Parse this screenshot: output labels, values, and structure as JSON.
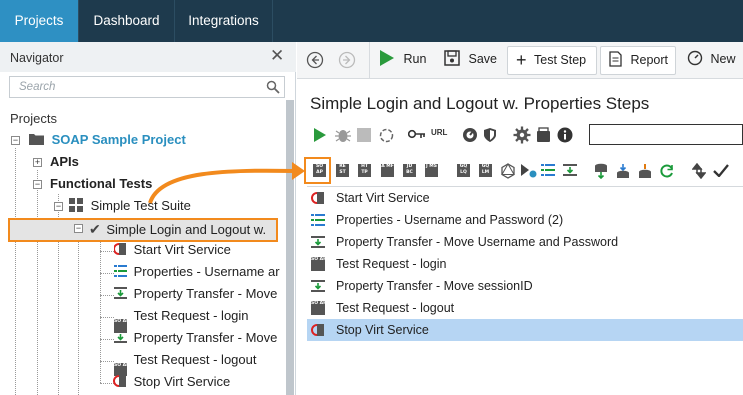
{
  "top_tabs": [
    {
      "label": "Projects",
      "active": true
    },
    {
      "label": "Dashboard",
      "active": false
    },
    {
      "label": "Integrations",
      "active": false
    }
  ],
  "navigator": {
    "title": "Navigator",
    "close_icon": "close-icon",
    "search_placeholder": "Search",
    "projects_label": "Projects",
    "tree": {
      "project": "SOAP Sample Project",
      "apis": "APIs",
      "functional_tests": "Functional Tests",
      "suite": "Simple Test Suite",
      "test_case": "Simple Login and Logout w.",
      "steps": [
        {
          "label": "Start Virt Service",
          "icon": "virt-service-icon"
        },
        {
          "label": "Properties - Username ar",
          "icon": "properties-icon"
        },
        {
          "label": "Property Transfer - Move",
          "icon": "property-transfer-icon"
        },
        {
          "label": "Test Request - login",
          "icon": "soap-request-icon"
        },
        {
          "label": "Property Transfer - Move",
          "icon": "property-transfer-icon"
        },
        {
          "label": "Test Request - logout",
          "icon": "soap-request-icon"
        },
        {
          "label": "Stop Virt Service",
          "icon": "virt-service-icon"
        }
      ]
    }
  },
  "toolbar": {
    "run_label": "Run",
    "save_label": "Save",
    "test_step_label": "Test Step",
    "report_label": "Report",
    "new_label": "New"
  },
  "editor": {
    "title": "Simple Login and Logout w. Properties Steps",
    "url_label": "URL",
    "step_type_labels": [
      "SO AP",
      "RE ST",
      "HT TP",
      "A MF",
      "JD BC",
      "J MS",
      "GQ LQ",
      "GQ LM"
    ],
    "steps": [
      {
        "label": "Start Virt Service",
        "icon": "virt-service-icon",
        "selected": false
      },
      {
        "label": "Properties - Username and Password (2)",
        "icon": "properties-icon",
        "selected": false
      },
      {
        "label": "Property Transfer - Move Username and Password",
        "icon": "property-transfer-icon",
        "selected": false
      },
      {
        "label": "Test Request - login",
        "icon": "soap-request-icon",
        "selected": false
      },
      {
        "label": "Property Transfer - Move sessionID",
        "icon": "property-transfer-icon",
        "selected": false
      },
      {
        "label": "Test Request - logout",
        "icon": "soap-request-icon",
        "selected": false
      },
      {
        "label": "Stop Virt Service",
        "icon": "virt-service-icon",
        "selected": true
      }
    ]
  },
  "colors": {
    "topbar": "#1e3a4d",
    "active_tab": "#2e90c3",
    "highlight": "#f28a1d",
    "selection": "#b6d5f3",
    "project_link": "#2a8fbf",
    "run_green": "#2a9a3c"
  }
}
